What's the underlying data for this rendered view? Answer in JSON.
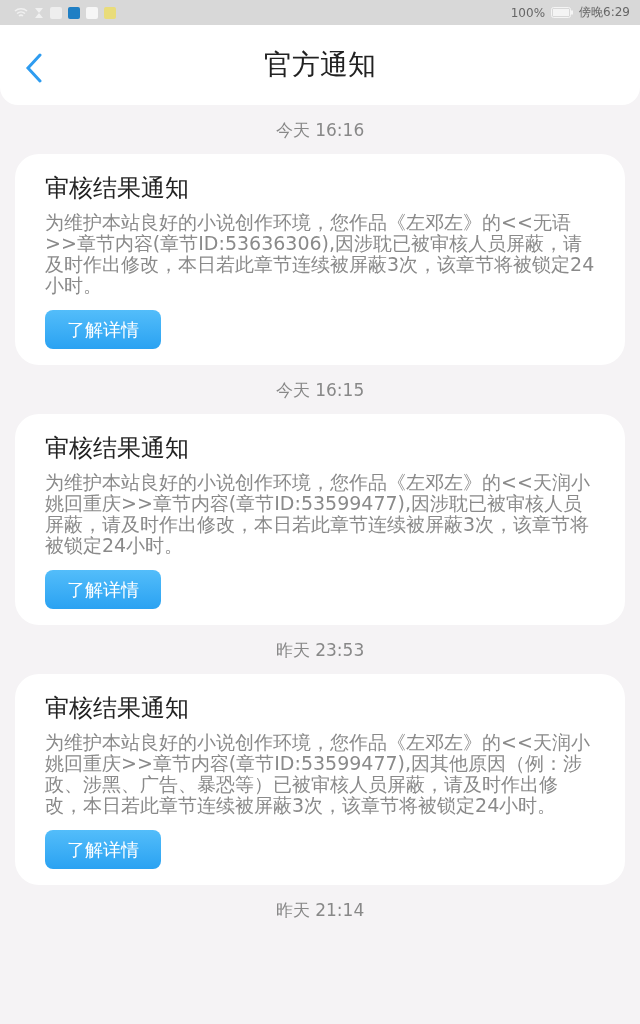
{
  "status_bar": {
    "battery": "100%",
    "time": "傍晚6:29"
  },
  "header": {
    "title": "官方通知"
  },
  "messages": [
    {
      "time": "今天 16:16",
      "title": "审核结果通知",
      "body": "为维护本站良好的小说创作环境，您作品《左邓左》的<<无语>>章节内容(章节ID:53636306),因涉耽已被审核人员屏蔽，请及时作出修改，本日若此章节连续被屏蔽3次，该章节将被锁定24小时。",
      "button": "了解详情"
    },
    {
      "time": "今天 16:15",
      "title": "审核结果通知",
      "body": "为维护本站良好的小说创作环境，您作品《左邓左》的<<天润小姚回重庆>>章节内容(章节ID:53599477),因涉耽已被审核人员屏蔽，请及时作出修改，本日若此章节连续被屏蔽3次，该章节将被锁定24小时。",
      "button": "了解详情"
    },
    {
      "time": "昨天 23:53",
      "title": "审核结果通知",
      "body": "为维护本站良好的小说创作环境，您作品《左邓左》的<<天润小姚回重庆>>章节内容(章节ID:53599477),因其他原因（例：涉政、涉黑、广告、暴恐等）已被审核人员屏蔽，请及时作出修改，本日若此章节连续被屏蔽3次，该章节将被锁定24小时。",
      "button": "了解详情"
    }
  ],
  "last_time": "昨天 21:14"
}
